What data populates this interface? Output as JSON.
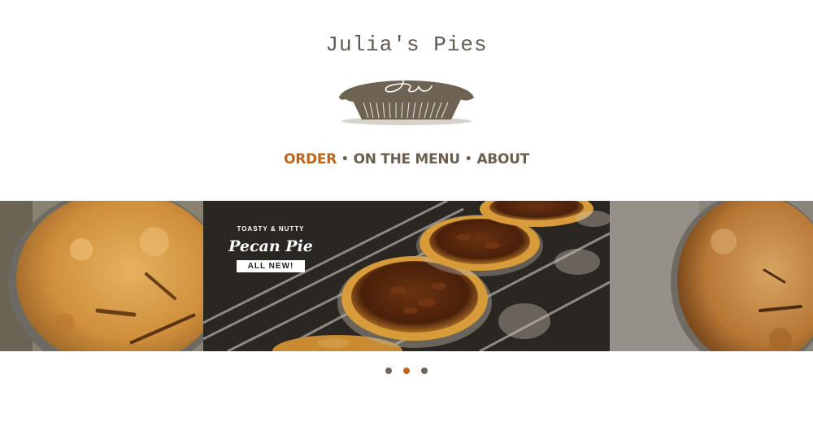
{
  "site": {
    "title": "Julia's Pies",
    "logo_monogram": "Jw"
  },
  "nav": {
    "items": [
      {
        "label": "ORDER",
        "active": true
      },
      {
        "label": "ON THE MENU",
        "active": false
      },
      {
        "label": "ABOUT",
        "active": false
      }
    ],
    "separator": "•"
  },
  "carousel": {
    "featured_badge": {
      "top_text": "TOASTY & NUTTY",
      "title": "Pecan Pie",
      "ribbon": "ALL NEW!"
    },
    "active_index": 1,
    "dot_count": 3
  },
  "colors": {
    "accent": "#c0641a",
    "text": "#6b5f4f",
    "logo": "#6e6353"
  }
}
